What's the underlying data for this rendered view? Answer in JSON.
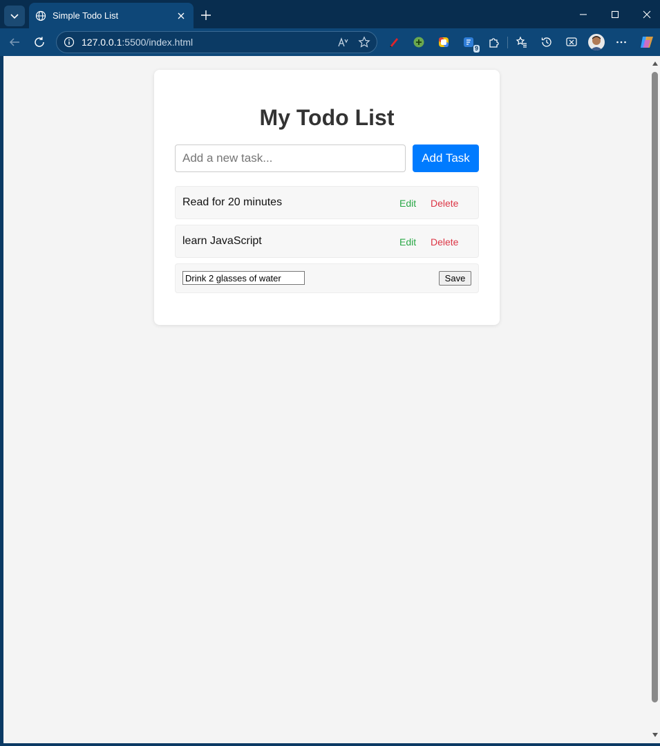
{
  "browser": {
    "tab_title": "Simple Todo List",
    "url_host": "127.0.0.1",
    "url_path": ":5500/index.html",
    "extension_badge": "9"
  },
  "page": {
    "heading": "My Todo List",
    "input_placeholder": "Add a new task...",
    "add_button": "Add Task",
    "todos": [
      {
        "text": "Read for 20 minutes",
        "edit": "Edit",
        "delete": "Delete"
      },
      {
        "text": "learn JavaScript",
        "edit": "Edit",
        "delete": "Delete"
      }
    ],
    "editing": {
      "value": "Drink 2 glasses of water",
      "save": "Save"
    }
  },
  "colors": {
    "accent": "#007bff",
    "edit": "#28a745",
    "delete": "#dc3545"
  }
}
